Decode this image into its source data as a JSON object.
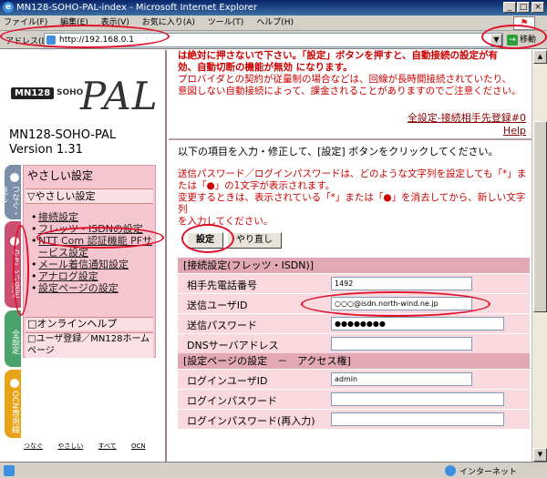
{
  "window": {
    "title": "MN128-SOHO-PAL-index - Microsoft Internet Explorer",
    "ie_glyph": "e",
    "minimize": "_",
    "maximize": "□",
    "close": "×"
  },
  "menu": {
    "items": [
      "ファイル(F)",
      "編集(E)",
      "表示(V)",
      "お気に入り(A)",
      "ツール(T)",
      "ヘルプ(H)"
    ]
  },
  "address": {
    "label": "アドレス(D)",
    "url": "http://192.168.0.1",
    "dropdown": "▼",
    "go_label": "移動",
    "go_arrow": "→"
  },
  "left": {
    "logo": {
      "mn": "MN128",
      "soho": "SOHO",
      "pal": "PAL"
    },
    "product_name": "MN128-SOHO-PAL",
    "version": "Version 1.31",
    "tabs": {
      "tsunagu": "つなぐ・見る",
      "yasashii": "やさしい設定",
      "zen": "全設定",
      "ocn": "OCN専用線"
    },
    "panel": {
      "title": "やさしい設定",
      "sub": "▽やさしい設定",
      "items": [
        "接続設定",
        "フレッツ・ISDNの設定",
        "NTT Com 認証機能 PFサービス設定",
        "メール着信通知設定",
        "アナログ設定",
        "設定ページの設定"
      ],
      "help": "□オンラインヘルプ",
      "register": "□ユーザ登録／MN128ホームページ"
    },
    "bottom_links": [
      "つなぐ",
      "やさしい",
      "すべて",
      "OCN"
    ]
  },
  "right": {
    "warning_lines": [
      "は絶対に押さないで下さい。「設定」ボタンを押すと、自動接続の設定が有",
      "効、自動切断の機能が無効 になります。",
      "プロバイダとの契約が従量制の場合などは、回線が長時間接続されていたり、",
      "意図しない自動接続によって、課金されることがありますのでご注意ください。"
    ],
    "link_setting": "全設定-接続相手先登録#0",
    "link_help": "Help",
    "instruction": "以下の項目を入力・修正して、[設定] ボタンをクリックしてください。",
    "note_lines": [
      "送信パスワード／ログインパスワードは、どのような文字列を設定しても「*」ま",
      "たは「●」の1文字が表示されます。",
      "変更するときは、表示されている「*」または「●」を消去してから、新しい文字列",
      "を入力してください。"
    ],
    "btn_set": "設定",
    "btn_redo": "やり直し",
    "section_connection": "[接続設定(フレッツ・ISDN)]",
    "fields_connection": [
      {
        "label": "相手先電話番号",
        "value": "1492"
      },
      {
        "label": "送信ユーザID",
        "value": "○○○@isdn.north-wind.ne.jp"
      },
      {
        "label": "送信パスワード",
        "value": "●●●●●●●●"
      },
      {
        "label": "DNSサーバアドレス",
        "value": ""
      }
    ],
    "section_page": "[設定ページの設定　－　アクセス権]",
    "fields_page": [
      {
        "label": "ログインユーザID",
        "value": "admin"
      },
      {
        "label": "ログインパスワード",
        "value": ""
      },
      {
        "label": "ログインパスワード(再入力)",
        "value": ""
      }
    ]
  },
  "scroll": {
    "up": "▲",
    "down": "▼"
  },
  "status": {
    "zone": "インターネット"
  },
  "colors": {
    "annotation_red": "#e0102a",
    "panel_pink": "#f5c6cf",
    "warning_red": "#cc0000"
  }
}
